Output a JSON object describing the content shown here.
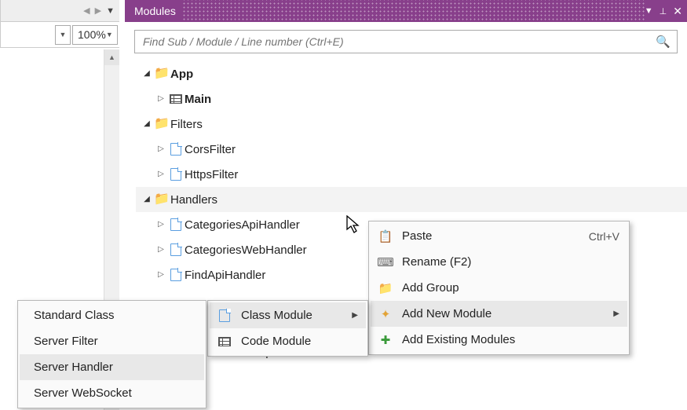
{
  "toolbar": {
    "zoom_value": "100%"
  },
  "panel": {
    "title": "Modules"
  },
  "search": {
    "placeholder": "Find Sub / Module / Line number (Ctrl+E)"
  },
  "tree": {
    "app": "App",
    "main": "Main",
    "filters": "Filters",
    "cors": "CorsFilter",
    "https": "HttpsFilter",
    "handlers": "Handlers",
    "categoriesApi": "CategoriesApiHandler",
    "categoriesWeb": "CategoriesWebHandler",
    "findApi": "FindApiHandler",
    "productsApi": "ProductsApiHandler"
  },
  "contextMenu1": {
    "paste": "Paste",
    "paste_shortcut": "Ctrl+V",
    "rename": "Rename (F2)",
    "addGroup": "Add Group",
    "addNew": "Add New Module",
    "addExisting": "Add Existing Modules"
  },
  "contextMenu2": {
    "classModule": "Class Module",
    "codeModule": "Code Module"
  },
  "contextMenu3": {
    "standard": "Standard Class",
    "filter": "Server Filter",
    "handler": "Server Handler",
    "websocket": "Server WebSocket"
  }
}
